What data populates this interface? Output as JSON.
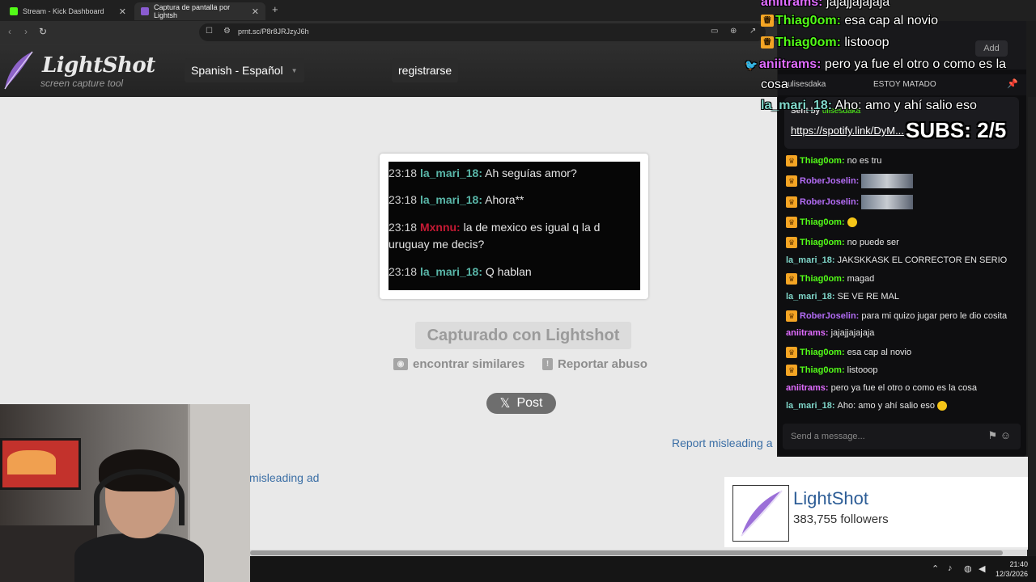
{
  "tabs": [
    {
      "label": "Stream - Kick Dashboard",
      "favicon_color": "#53fc18"
    },
    {
      "label": "Captura de pantalla por Lightsh",
      "favicon_color": "#8a5cd1"
    }
  ],
  "url": "prnt.sc/P8r8JRJzyJ6h",
  "lightshot": {
    "logo_title": "LightShot",
    "logo_subtitle": "screen capture tool",
    "language": "Spanish - Español",
    "register": "registrarse",
    "captured": "Capturado con Lightshot",
    "find_similar": "encontrar similares",
    "report_abuse": "Reportar abuso",
    "post": "Post",
    "report_ad_1": "Report misleading a",
    "report_ad_2": "misleading ad",
    "fb_name": "LightShot",
    "fb_followers": "383,755 followers"
  },
  "screenshot_chat": [
    {
      "time": "23:18",
      "user": "la_mari_18:",
      "text": " Ah seguías amor?",
      "color": "mari"
    },
    {
      "time": "23:18",
      "user": "la_mari_18:",
      "text": " Ahora**",
      "color": "mari"
    },
    {
      "time": "23:18",
      "user": "Mxnnu:",
      "text": " la de mexico es igual q la d",
      "color": "red"
    },
    {
      "time": "",
      "user": "",
      "text": "uruguay me decis?",
      "color": "none"
    },
    {
      "time": "23:18",
      "user": "la_mari_18:",
      "text": " Q hablan",
      "color": "mari"
    }
  ],
  "kick_chat": {
    "add_label": "Add",
    "header_user": "ulisesdaka",
    "header_title": "ESTOY MATADO",
    "pinned_sent_by": "Sent by",
    "pinned_user": "ulisesdaka",
    "pinned_link": "https://spotify.link/DyM...",
    "subs": "SUBS: 2/5",
    "input_placeholder": "Send a message...",
    "messages": [
      {
        "crown": true,
        "user": "Thiag0om:",
        "color": "#53fc18",
        "text": "no es tru"
      },
      {
        "crown": true,
        "user": "RoberJoselin:",
        "color": "#b36cf5",
        "text": "",
        "emote": true
      },
      {
        "crown": true,
        "user": "RoberJoselin:",
        "color": "#b36cf5",
        "text": "",
        "emote": true
      },
      {
        "crown": true,
        "user": "Thiag0om:",
        "color": "#53fc18",
        "text": "",
        "emoji": true
      },
      {
        "crown": true,
        "user": "Thiag0om:",
        "color": "#53fc18",
        "text": "no puede ser"
      },
      {
        "crown": false,
        "user": "la_mari_18:",
        "color": "#7fd6c9",
        "text": "JAKSKKASK EL CORRECTOR EN SERIO"
      },
      {
        "crown": true,
        "user": "Thiag0om:",
        "color": "#53fc18",
        "text": "magad"
      },
      {
        "crown": false,
        "user": "la_mari_18:",
        "color": "#7fd6c9",
        "text": "SE VE RE MAL"
      },
      {
        "crown": true,
        "user": "RoberJoselin:",
        "color": "#b36cf5",
        "text": "para mi quizo jugar pero le dio cosita"
      },
      {
        "crown": false,
        "user": "aniitrams:",
        "color": "#e06cff",
        "text": "jajajjajajaja"
      },
      {
        "crown": true,
        "user": "Thiag0om:",
        "color": "#53fc18",
        "text": "esa cap al novio"
      },
      {
        "crown": true,
        "user": "Thiag0om:",
        "color": "#53fc18",
        "text": "listooop"
      },
      {
        "crown": false,
        "user": "aniitrams:",
        "color": "#e06cff",
        "text": "pero ya fue el otro o como es la cosa"
      },
      {
        "crown": false,
        "user": "la_mari_18:",
        "color": "#7fd6c9",
        "text": "Aho: amo y ahí salio eso",
        "emoji": true
      }
    ]
  },
  "overlay_chat": [
    {
      "crown": false,
      "user": "aniitrams:",
      "color": "#e06cff",
      "text": " jajajjajajaja"
    },
    {
      "crown": true,
      "user": "Thiag0om:",
      "color": "#53fc18",
      "text": " esa cap al novio"
    },
    {
      "crown": true,
      "user": "Thiag0om:",
      "color": "#53fc18",
      "text": " listooop"
    },
    {
      "crown": false,
      "user": "aniitrams:",
      "color": "#e06cff",
      "text": " pero ya fue el otro o como es la",
      "twitter": true
    },
    {
      "crown": false,
      "user": "",
      "color": "#fff",
      "text": "cosa"
    },
    {
      "crown": false,
      "user": "la_mari_18:",
      "color": "#7fd6c9",
      "text": " Aho: amo y ahí salio eso"
    }
  ],
  "taskbar": {
    "time": "21:40",
    "date": "12/3/2026"
  }
}
